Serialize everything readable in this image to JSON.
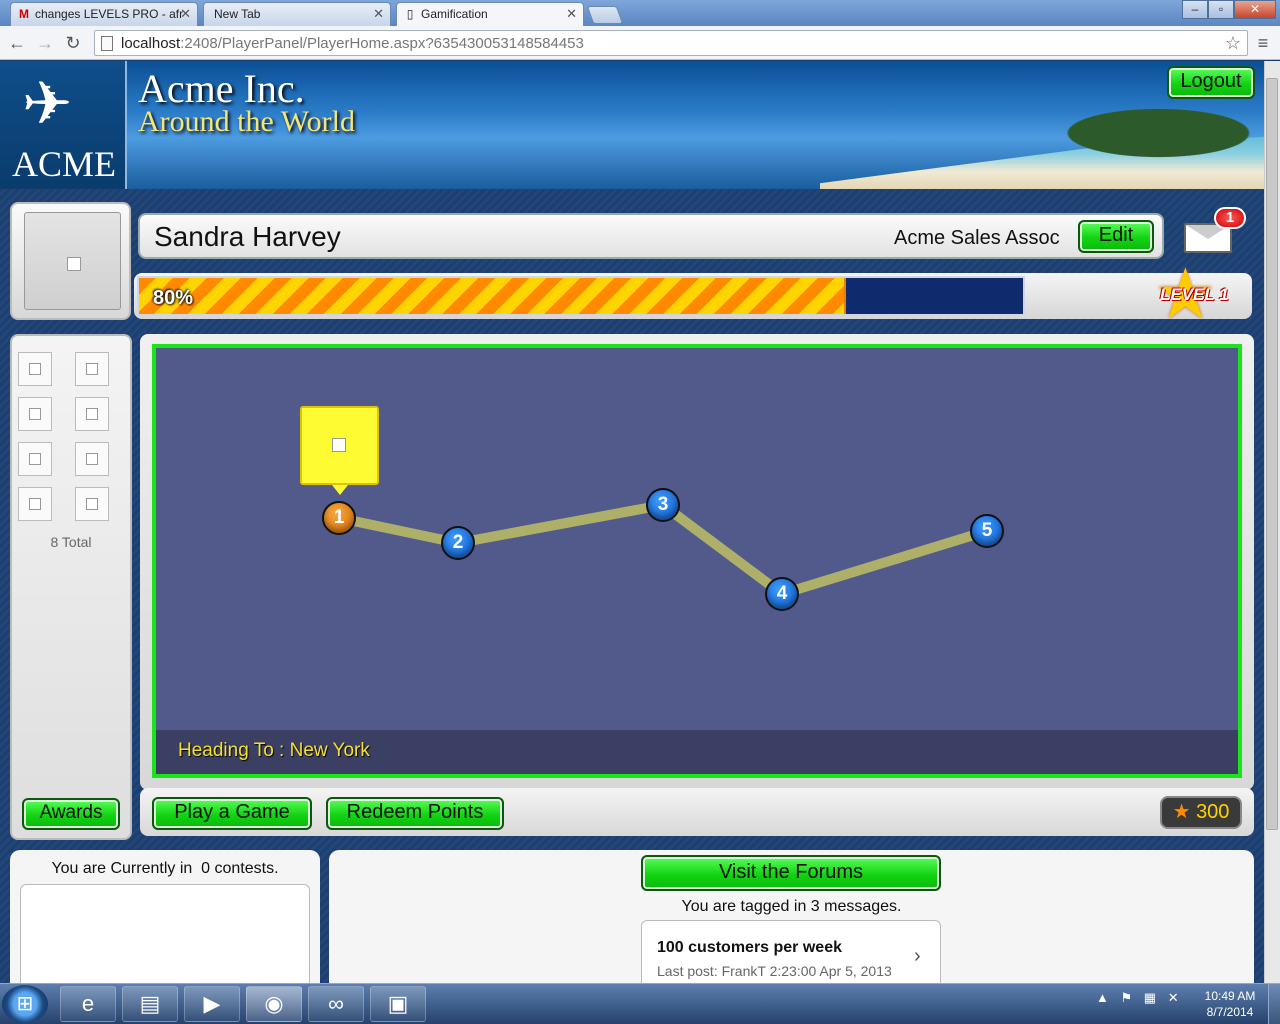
{
  "browser": {
    "tabs": [
      {
        "label": "changes LEVELS PRO - afr",
        "icon": "gmail-icon",
        "icon_glyph": "M"
      },
      {
        "label": "New Tab",
        "icon": "none"
      },
      {
        "label": "Gamification",
        "icon": "page-icon"
      }
    ],
    "url_host": "localhost",
    "url_rest": ":2408/PlayerPanel/PlayerHome.aspx?635430053148584453",
    "window_buttons": [
      "–",
      "▫",
      "✕"
    ]
  },
  "header": {
    "logo_text": "ACME",
    "company": "Acme Inc.",
    "tagline": "Around the World",
    "logout_label": "Logout"
  },
  "profile": {
    "name": "Sandra Harvey",
    "title": "Acme Sales Assoc",
    "edit_label": "Edit",
    "messages_badge": "1",
    "progress_percent": 80,
    "progress_label": "80%",
    "level_label": "LEVEL 1"
  },
  "awards": {
    "count": 8,
    "total_label": "8 Total",
    "button_label": "Awards"
  },
  "map": {
    "heading_to": "Heading To : New York",
    "stops": [
      {
        "number": "1",
        "status": "current"
      },
      {
        "number": "2",
        "status": "upcoming"
      },
      {
        "number": "3",
        "status": "upcoming"
      },
      {
        "number": "4",
        "status": "upcoming"
      },
      {
        "number": "5",
        "status": "upcoming"
      }
    ],
    "route_color": "#aeb06a",
    "border_color": "#19e519"
  },
  "actions": {
    "play_label": "Play a Game",
    "redeem_label": "Redeem Points",
    "points_star": "★",
    "points_value": "300"
  },
  "contests": {
    "text": "You are Currently in  0 contests."
  },
  "forums": {
    "button_label": "Visit the Forums",
    "tagged_text": "You are tagged in 3 messages.",
    "message": {
      "title": "100 customers per week",
      "meta": "Last post: FrankT 2:23:00 Apr 5, 2013"
    }
  },
  "taskbar": {
    "apps": [
      {
        "name": "ie-icon",
        "glyph": "e"
      },
      {
        "name": "explorer-icon",
        "glyph": "▤"
      },
      {
        "name": "media-player-icon",
        "glyph": "▶"
      },
      {
        "name": "chrome-icon",
        "glyph": "◉"
      },
      {
        "name": "infinity-app-icon",
        "glyph": "∞"
      },
      {
        "name": "photo-viewer-icon",
        "glyph": "▣"
      }
    ],
    "time": "10:49 AM",
    "date": "8/7/2014"
  }
}
